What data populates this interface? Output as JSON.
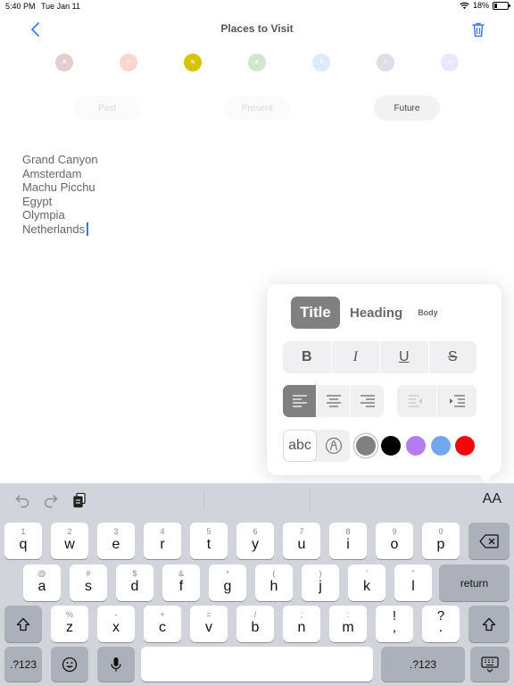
{
  "status": {
    "time": "5:40 PM",
    "date": "Tue Jan 11",
    "battery": "18%",
    "battery_level": 0.18
  },
  "nav": {
    "title": "Places to Visit"
  },
  "dots": [
    {
      "letter": "R",
      "color": "#e6cdcd"
    },
    {
      "letter": "I",
      "color": "#fad6cc"
    },
    {
      "letter": "N",
      "color": "#d7c400"
    },
    {
      "letter": "B",
      "color": "#d2e6cf"
    },
    {
      "letter": "F",
      "color": "#deeafc"
    },
    {
      "letter": "I",
      "color": "#dcdfe6"
    },
    {
      "letter": "S",
      "color": "#ece5fb"
    }
  ],
  "segments": {
    "past": "Past",
    "present": "Present",
    "future": "Future"
  },
  "notes": [
    "Grand Canyon",
    "Amsterdam",
    "Machu Picchu",
    "Egypt",
    "Olympia",
    "Netherlands"
  ],
  "popover": {
    "styles": {
      "title": "Title",
      "heading": "Heading",
      "body": "Body"
    },
    "format": {
      "bold": "B",
      "italic": "I",
      "underline": "U",
      "strike": "S"
    },
    "abc": "abc",
    "colors": [
      "#808080",
      "#000000",
      "#b57cf2",
      "#73a8f0",
      "#f10909"
    ]
  },
  "keyboard": {
    "aa": "AA",
    "row1": [
      {
        "hint": "1",
        "key": "q"
      },
      {
        "hint": "2",
        "key": "w"
      },
      {
        "hint": "3",
        "key": "e"
      },
      {
        "hint": "4",
        "key": "r"
      },
      {
        "hint": "5",
        "key": "t"
      },
      {
        "hint": "6",
        "key": "y"
      },
      {
        "hint": "7",
        "key": "u"
      },
      {
        "hint": "8",
        "key": "i"
      },
      {
        "hint": "9",
        "key": "o"
      },
      {
        "hint": "0",
        "key": "p"
      }
    ],
    "row2": [
      {
        "hint": "@",
        "key": "a"
      },
      {
        "hint": "#",
        "key": "s"
      },
      {
        "hint": "$",
        "key": "d"
      },
      {
        "hint": "&",
        "key": "f"
      },
      {
        "hint": "*",
        "key": "g"
      },
      {
        "hint": "(",
        "key": "h"
      },
      {
        "hint": ")",
        "key": "j"
      },
      {
        "hint": "'",
        "key": "k"
      },
      {
        "hint": "\"",
        "key": "l"
      }
    ],
    "row3": [
      {
        "hint": "%",
        "key": "z"
      },
      {
        "hint": "-",
        "key": "x"
      },
      {
        "hint": "+",
        "key": "c"
      },
      {
        "hint": "=",
        "key": "v"
      },
      {
        "hint": "/",
        "key": "b"
      },
      {
        "hint": ";",
        "key": "n"
      },
      {
        "hint": ":",
        "key": "m"
      },
      {
        "hint": "!",
        "key": ","
      },
      {
        "hint": "?",
        "key": "."
      }
    ],
    "return": "return",
    "numbers": ".?123"
  }
}
